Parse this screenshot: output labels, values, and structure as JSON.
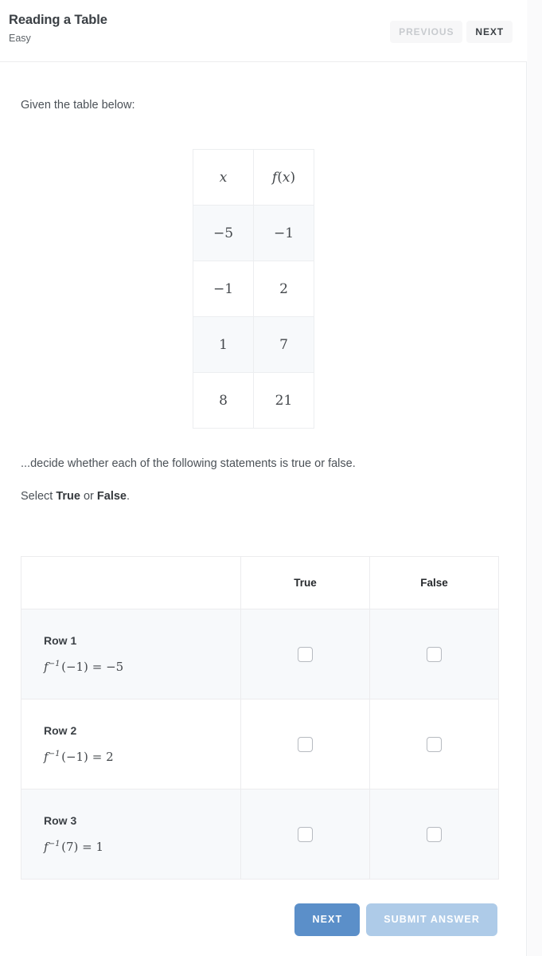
{
  "header": {
    "title": "Reading a Table",
    "difficulty": "Easy",
    "previous_label": "PREVIOUS",
    "next_label": "NEXT"
  },
  "body": {
    "intro": "Given the table below:",
    "decide": "...decide whether each of the following statements is true or false.",
    "select_prefix": "Select ",
    "select_true": "True",
    "select_middle": " or ",
    "select_false": "False",
    "select_suffix": "."
  },
  "data_table": {
    "headers": {
      "x": "x",
      "fx_f": "f",
      "fx_open": "(",
      "fx_x": "x",
      "fx_close": ")"
    },
    "rows": [
      {
        "x": "−5",
        "fx": "−1"
      },
      {
        "x": "−1",
        "fx": "2"
      },
      {
        "x": "1",
        "fx": "7"
      },
      {
        "x": "8",
        "fx": "21"
      }
    ]
  },
  "answer_table": {
    "columns": {
      "statement": "",
      "true": "True",
      "false": "False"
    },
    "rows": [
      {
        "label": "Row 1",
        "eq_fn": "f",
        "eq_sup": "−1",
        "eq_arg": "(−1)",
        "eq_rel": "=",
        "eq_val": "−5",
        "true_checked": false,
        "false_checked": false
      },
      {
        "label": "Row 2",
        "eq_fn": "f",
        "eq_sup": "−1",
        "eq_arg": "(−1)",
        "eq_rel": "=",
        "eq_val": "2",
        "true_checked": false,
        "false_checked": false
      },
      {
        "label": "Row 3",
        "eq_fn": "f",
        "eq_sup": "−1",
        "eq_arg": "(7)",
        "eq_rel": "=",
        "eq_val": "1",
        "true_checked": false,
        "false_checked": false
      }
    ]
  },
  "footer": {
    "next_label": "NEXT",
    "submit_label": "SUBMIT ANSWER"
  },
  "colors": {
    "next_button": "#5b8fc9",
    "submit_button": "#aecbe8",
    "card_background": "#ffffff",
    "stripe": "#f7f9fb",
    "border": "#eceef0",
    "text": "#4b5157"
  }
}
